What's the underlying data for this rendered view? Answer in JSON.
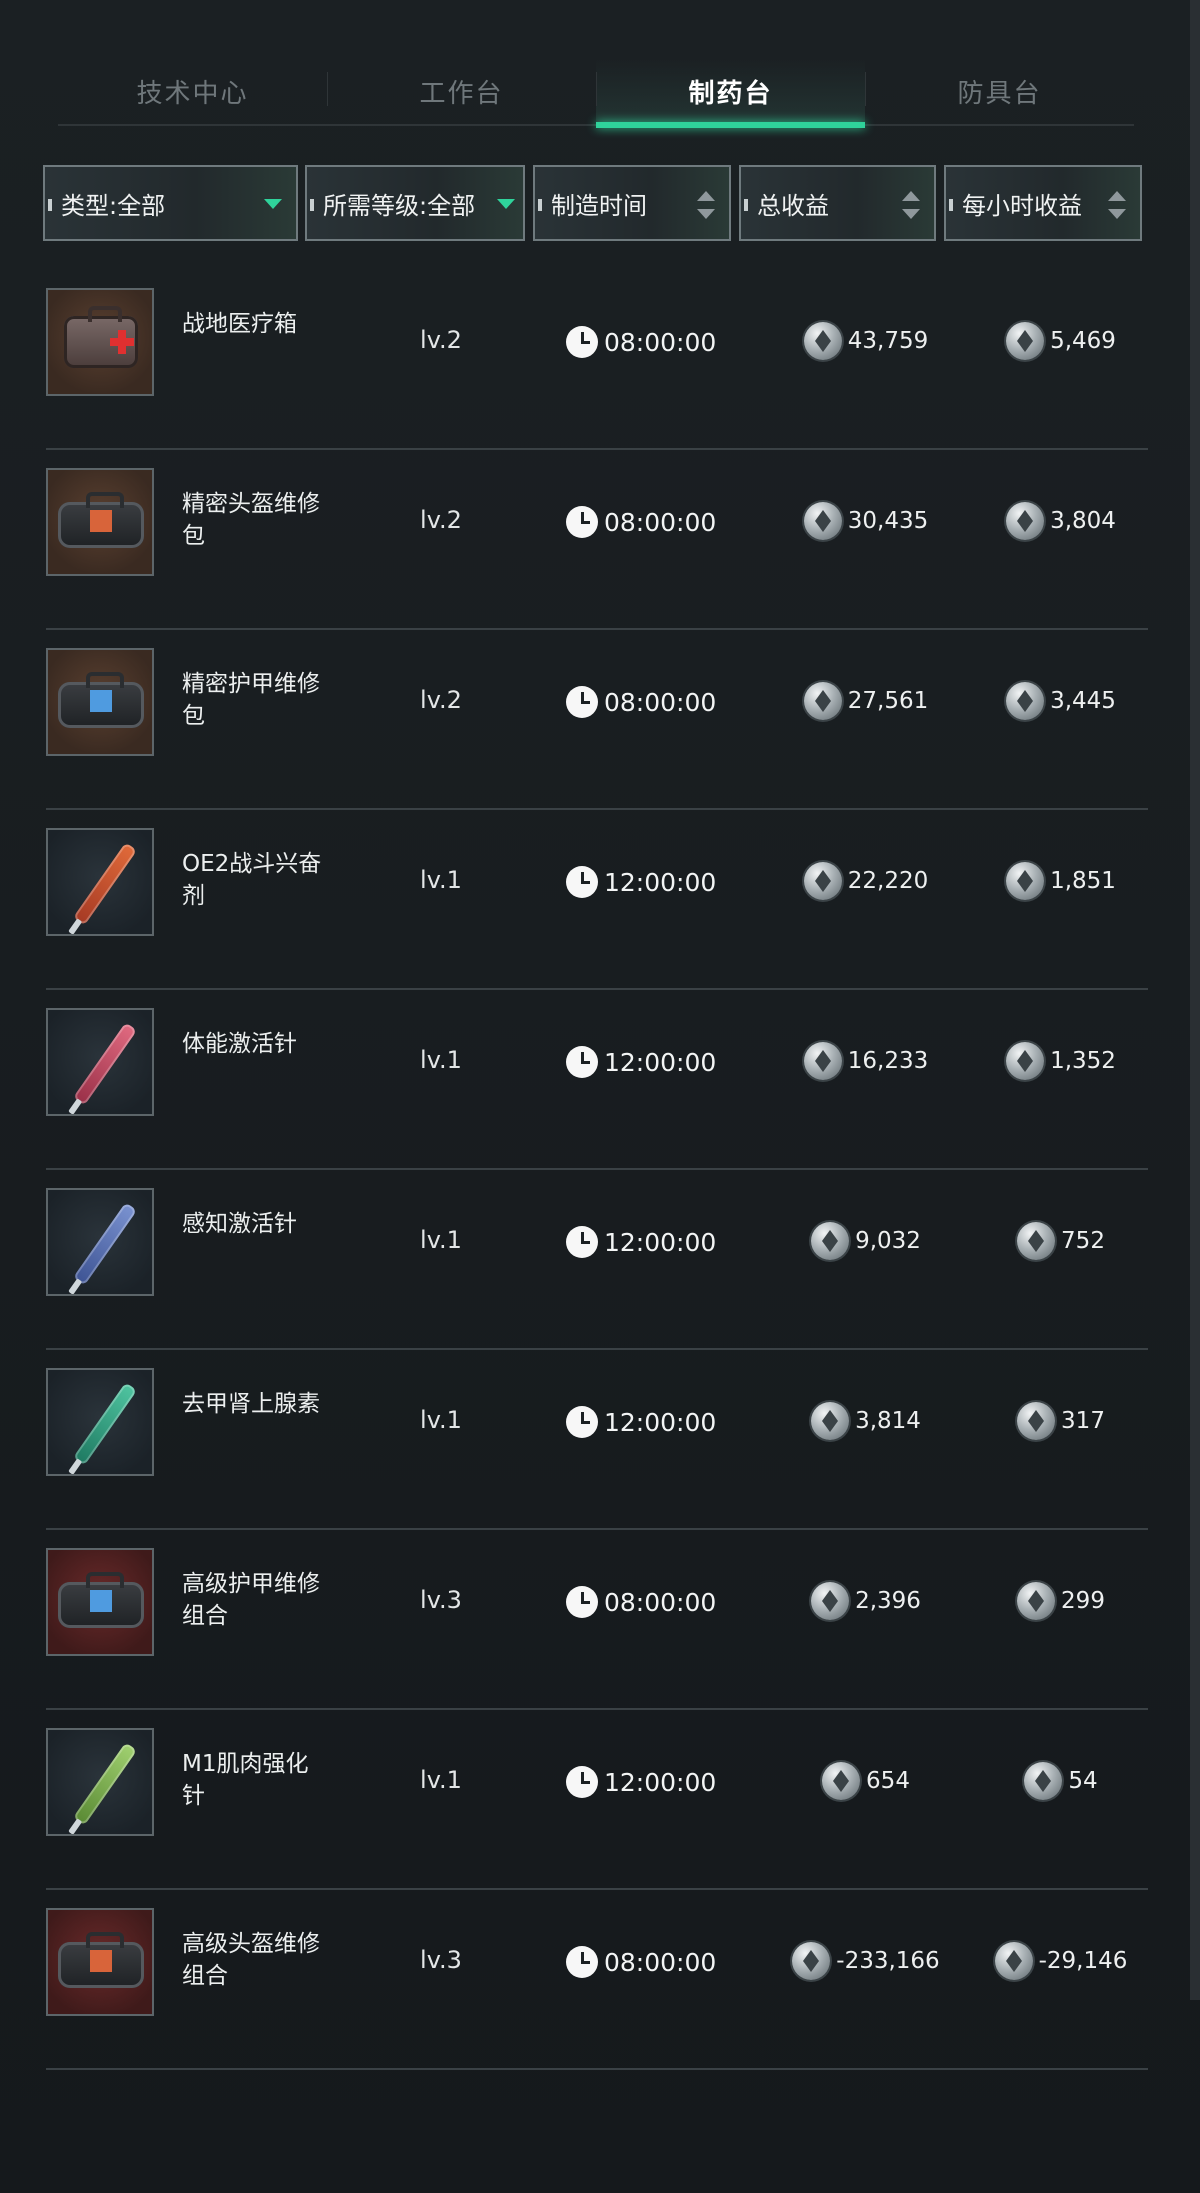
{
  "tabs": [
    {
      "label": "技术中心",
      "active": false
    },
    {
      "label": "工作台",
      "active": false
    },
    {
      "label": "制药台",
      "active": true
    },
    {
      "label": "防具台",
      "active": false
    }
  ],
  "filters": {
    "type": "类型:全部",
    "level": "所需等级:全部",
    "craft_time": "制造时间",
    "total_profit": "总收益",
    "hourly_profit": "每小时收益"
  },
  "colors": {
    "accent": "#2fd39b",
    "background": "#181c1f"
  },
  "rows": [
    {
      "name": "战地医疗箱",
      "level": "lv.2",
      "time": "08:00:00",
      "total": "43,759",
      "hourly": "5,469",
      "icon": "medkit-icon",
      "bg": "brown"
    },
    {
      "name": "精密头盔维修包",
      "level": "lv.2",
      "time": "08:00:00",
      "total": "30,435",
      "hourly": "3,804",
      "icon": "helmet-repair-bag-icon",
      "bg": "brown"
    },
    {
      "name": "精密护甲维修包",
      "level": "lv.2",
      "time": "08:00:00",
      "total": "27,561",
      "hourly": "3,445",
      "icon": "armor-repair-bag-icon",
      "bg": "brown"
    },
    {
      "name": "OE2战斗兴奋剂",
      "level": "lv.1",
      "time": "12:00:00",
      "total": "22,220",
      "hourly": "1,851",
      "icon": "syringe-icon",
      "bg": "dark"
    },
    {
      "name": "体能激活针",
      "level": "lv.1",
      "time": "12:00:00",
      "total": "16,233",
      "hourly": "1,352",
      "icon": "syringe-icon",
      "bg": "dark"
    },
    {
      "name": "感知激活针",
      "level": "lv.1",
      "time": "12:00:00",
      "total": "9,032",
      "hourly": "752",
      "icon": "syringe-icon",
      "bg": "dark"
    },
    {
      "name": "去甲肾上腺素",
      "level": "lv.1",
      "time": "12:00:00",
      "total": "3,814",
      "hourly": "317",
      "icon": "syringe-icon",
      "bg": "dark"
    },
    {
      "name": "高级护甲维修组合",
      "level": "lv.3",
      "time": "08:00:00",
      "total": "2,396",
      "hourly": "299",
      "icon": "armor-repair-kit-icon",
      "bg": "red"
    },
    {
      "name": "M1肌肉强化针",
      "level": "lv.1",
      "time": "12:00:00",
      "total": "654",
      "hourly": "54",
      "icon": "syringe-icon",
      "bg": "dark"
    },
    {
      "name": "高级头盔维修组合",
      "level": "lv.3",
      "time": "08:00:00",
      "total": "-233,166",
      "hourly": "-29,146",
      "icon": "helmet-repair-kit-icon",
      "bg": "red"
    }
  ]
}
